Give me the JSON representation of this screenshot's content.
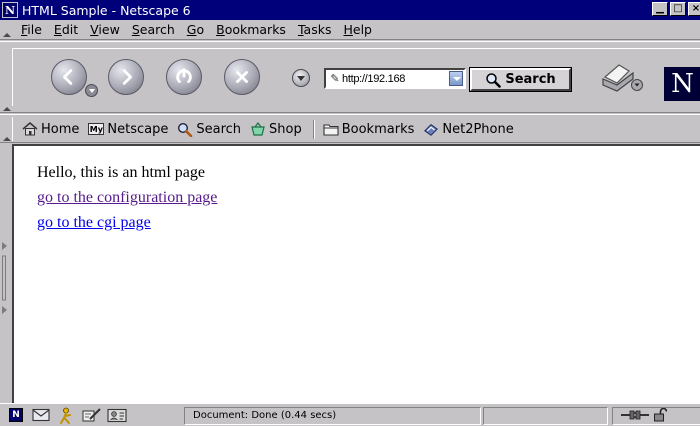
{
  "window": {
    "title": "HTML Sample - Netscape 6",
    "app_icon_letter": "N",
    "minimize": "▁",
    "maximize": "□",
    "close": "×"
  },
  "menu": [
    "File",
    "Edit",
    "View",
    "Search",
    "Go",
    "Bookmarks",
    "Tasks",
    "Help"
  ],
  "navigation": {
    "url": "http://192.168",
    "search_label": "Search",
    "logo_letter": "N"
  },
  "personal_toolbar": {
    "home": "Home",
    "netscape": "Netscape",
    "netscape_icon": "My",
    "search": "Search",
    "shop": "Shop",
    "bookmarks": "Bookmarks",
    "net2phone": "Net2Phone"
  },
  "page": {
    "greeting": "Hello, this is an html page",
    "link_config": "go to the configuration page",
    "link_cgi": "go to the cgi page"
  },
  "status": {
    "text": "Document: Done (0.44 secs)",
    "netscape_icon_letter": "N"
  },
  "colors": {
    "title_bar": "#00007b",
    "visited_link": "#551a8b",
    "link": "#0000ee"
  }
}
